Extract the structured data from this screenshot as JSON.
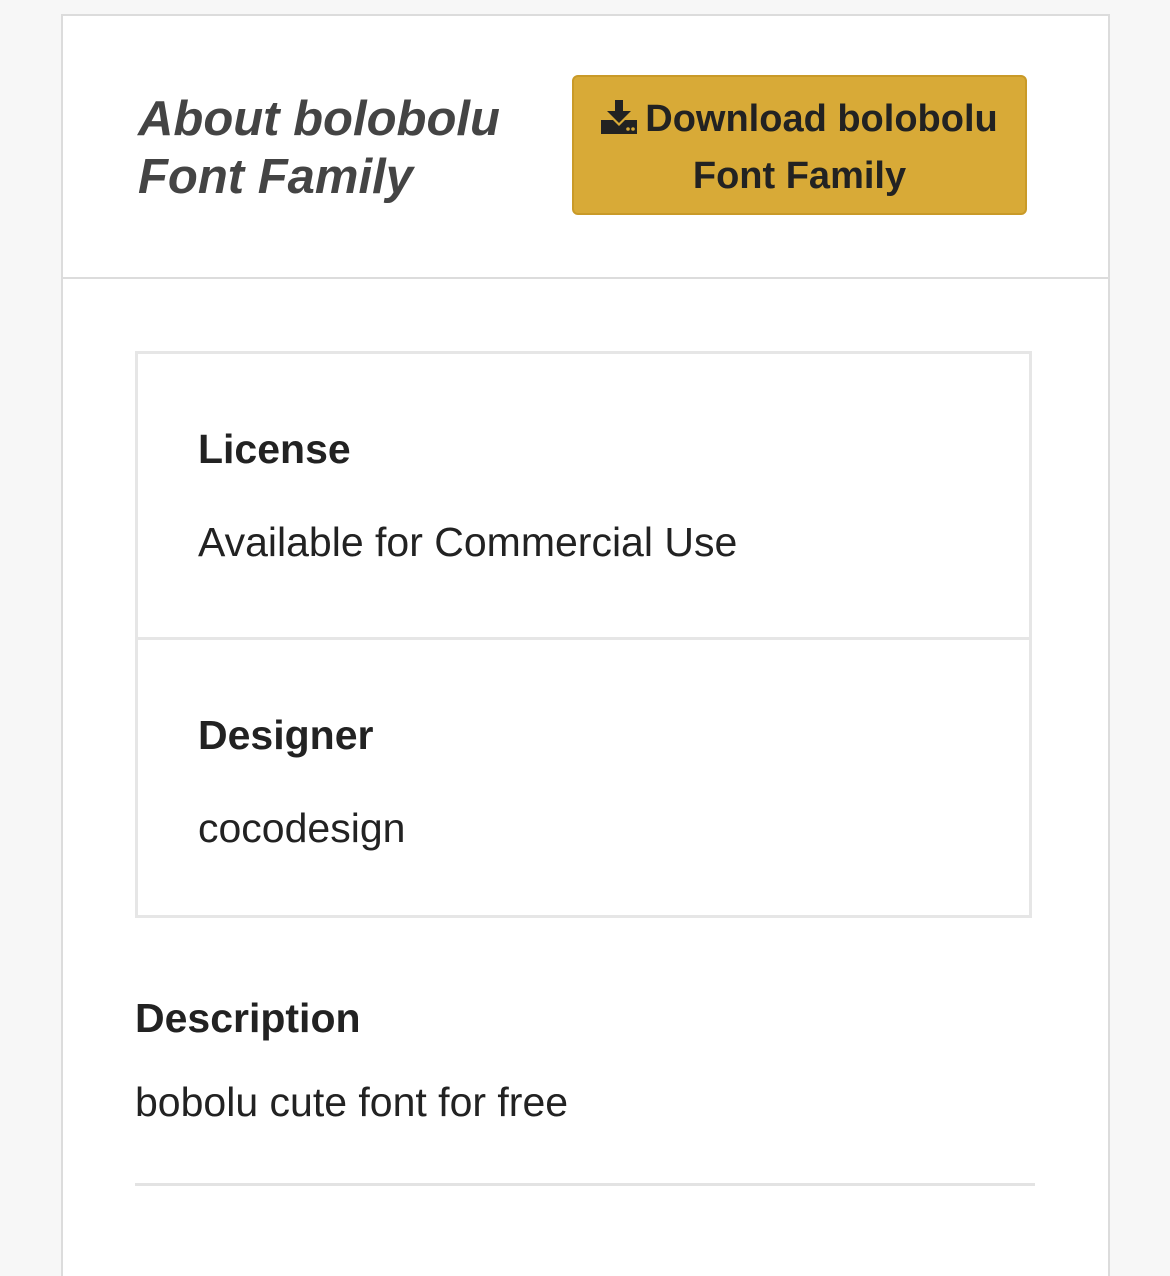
{
  "header": {
    "title": "About bolobolu Font Family",
    "download_label": "Download bolobolu Font Family",
    "download_icon": "download-icon",
    "download_color": "#d8aa37"
  },
  "info": {
    "license_label": "License",
    "license_value": "Available for Commercial Use",
    "designer_label": "Designer",
    "designer_value": "cocodesign"
  },
  "description": {
    "label": "Description",
    "text": "bobolu cute font for free"
  }
}
